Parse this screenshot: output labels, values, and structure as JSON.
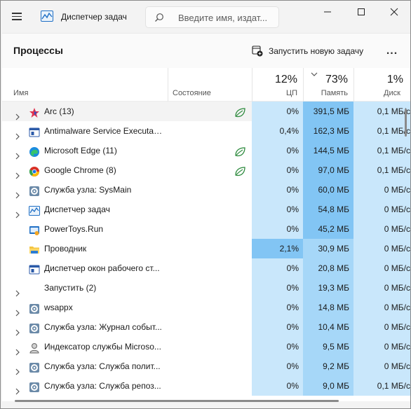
{
  "app": {
    "title": "Диспетчер задач"
  },
  "search": {
    "placeholder": "Введите имя, издат..."
  },
  "toolbar": {
    "page_title": "Процессы",
    "run_new_task": "Запустить новую задачу",
    "more": "..."
  },
  "columns": {
    "name": "Имя",
    "status": "Состояние",
    "cpu": {
      "percent": "12%",
      "label": "ЦП"
    },
    "memory": {
      "percent": "73%",
      "label": "Память"
    },
    "disk": {
      "percent": "1%",
      "label": "Диск"
    }
  },
  "colors": {
    "accent": "#0067c0",
    "heat_low": "#c9e7fb",
    "heat_mid": "#a6d7f8",
    "heat_high": "#82c5f4",
    "efficiency": "#2e8b3e"
  },
  "processes": [
    {
      "name": "Arc (13)",
      "icon": "arc-icon",
      "expandable": true,
      "efficiency": true,
      "cpu": "0%",
      "memory": "391,5 МБ",
      "disk": "0,1 МБ/с"
    },
    {
      "name": "Antimalware Service Executable",
      "icon": "service-window-icon",
      "expandable": true,
      "efficiency": false,
      "cpu": "0,4%",
      "memory": "162,3 МБ",
      "disk": "0,1 МБ/с"
    },
    {
      "name": "Microsoft Edge (11)",
      "icon": "edge-icon",
      "expandable": true,
      "efficiency": true,
      "cpu": "0%",
      "memory": "144,5 МБ",
      "disk": "0,1 МБ/с"
    },
    {
      "name": "Google Chrome (8)",
      "icon": "chrome-icon",
      "expandable": true,
      "efficiency": true,
      "cpu": "0%",
      "memory": "97,0 МБ",
      "disk": "0,1 МБ/с"
    },
    {
      "name": "Служба узла: SysMain",
      "icon": "gear-icon",
      "expandable": true,
      "efficiency": false,
      "cpu": "0%",
      "memory": "60,0 МБ",
      "disk": "0 МБ/с"
    },
    {
      "name": "Диспетчер задач",
      "icon": "task-manager-icon",
      "expandable": true,
      "efficiency": false,
      "cpu": "0%",
      "memory": "54,8 МБ",
      "disk": "0 МБ/с"
    },
    {
      "name": "PowerToys.Run",
      "icon": "powertoys-icon",
      "expandable": false,
      "efficiency": false,
      "cpu": "0%",
      "memory": "45,2 МБ",
      "disk": "0 МБ/с"
    },
    {
      "name": "Проводник",
      "icon": "folder-icon",
      "expandable": false,
      "efficiency": false,
      "cpu": "2,1%",
      "memory": "30,9 МБ",
      "disk": "0 МБ/с"
    },
    {
      "name": "Диспетчер окон рабочего ст...",
      "icon": "service-window-icon",
      "expandable": false,
      "efficiency": false,
      "cpu": "0%",
      "memory": "20,8 МБ",
      "disk": "0 МБ/с"
    },
    {
      "name": "Запустить (2)",
      "icon": "",
      "expandable": true,
      "efficiency": false,
      "cpu": "0%",
      "memory": "19,3 МБ",
      "disk": "0 МБ/с"
    },
    {
      "name": "wsappx",
      "icon": "gear-icon",
      "expandable": true,
      "efficiency": false,
      "cpu": "0%",
      "memory": "14,8 МБ",
      "disk": "0 МБ/с"
    },
    {
      "name": "Служба узла: Журнал событ...",
      "icon": "gear-icon",
      "expandable": true,
      "efficiency": false,
      "cpu": "0%",
      "memory": "10,4 МБ",
      "disk": "0 МБ/с"
    },
    {
      "name": "Индексатор службы Microso...",
      "icon": "indexer-icon",
      "expandable": true,
      "efficiency": false,
      "cpu": "0%",
      "memory": "9,5 МБ",
      "disk": "0 МБ/с"
    },
    {
      "name": "Служба узла: Служба полит...",
      "icon": "gear-icon",
      "expandable": true,
      "efficiency": false,
      "cpu": "0%",
      "memory": "9,2 МБ",
      "disk": "0 МБ/с"
    },
    {
      "name": "Служба узла: Служба репоз...",
      "icon": "gear-icon",
      "expandable": true,
      "efficiency": false,
      "cpu": "0%",
      "memory": "9,0 МБ",
      "disk": "0,1 МБ/с"
    }
  ]
}
